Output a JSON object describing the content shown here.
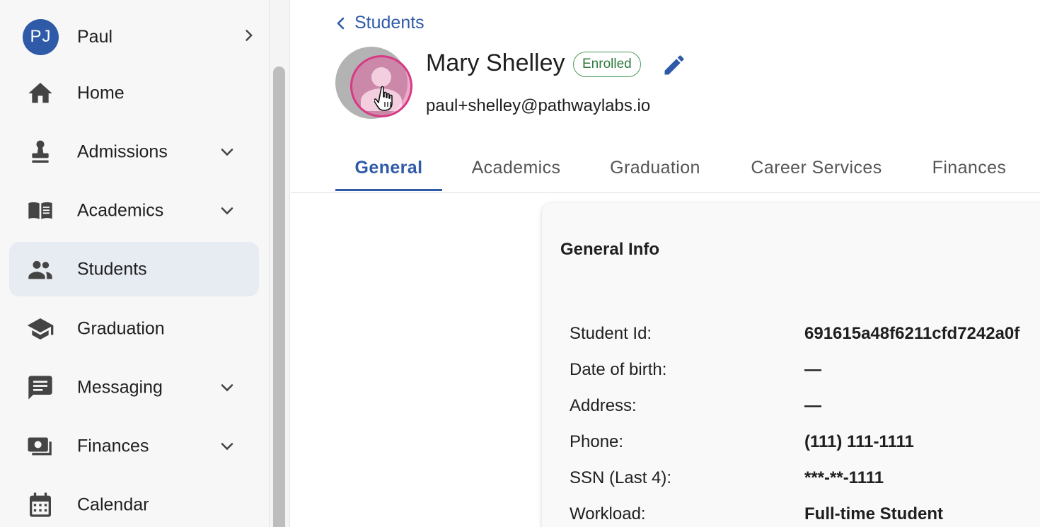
{
  "user": {
    "initials": "PJ",
    "name": "Paul"
  },
  "sidebar": {
    "items": [
      {
        "label": "Home",
        "icon": "home-icon",
        "has_chevron": false,
        "active": false
      },
      {
        "label": "Admissions",
        "icon": "stamp-icon",
        "has_chevron": true,
        "active": false
      },
      {
        "label": "Academics",
        "icon": "book-icon",
        "has_chevron": true,
        "active": false
      },
      {
        "label": "Students",
        "icon": "people-icon",
        "has_chevron": false,
        "active": true
      },
      {
        "label": "Graduation",
        "icon": "graduation-cap-icon",
        "has_chevron": false,
        "active": false
      },
      {
        "label": "Messaging",
        "icon": "message-icon",
        "has_chevron": true,
        "active": false
      },
      {
        "label": "Finances",
        "icon": "money-icon",
        "has_chevron": true,
        "active": false
      },
      {
        "label": "Calendar",
        "icon": "calendar-icon",
        "has_chevron": false,
        "active": false
      }
    ]
  },
  "breadcrumb": {
    "back_label": "Students"
  },
  "student": {
    "name": "Mary Shelley",
    "status": "Enrolled",
    "email": "paul+shelley@pathwaylabs.io"
  },
  "tabs": [
    {
      "label": "General",
      "active": true
    },
    {
      "label": "Academics",
      "active": false
    },
    {
      "label": "Graduation",
      "active": false
    },
    {
      "label": "Career Services",
      "active": false
    },
    {
      "label": "Finances",
      "active": false
    }
  ],
  "general_info": {
    "title": "General Info",
    "rows": [
      {
        "label": "Student Id:",
        "value": "691615a48f6211cfd7242a0f"
      },
      {
        "label": "Date of birth:",
        "value": "—"
      },
      {
        "label": "Address:",
        "value": "—"
      },
      {
        "label": "Phone:",
        "value": "(111) 111-1111"
      },
      {
        "label": "SSN (Last 4):",
        "value": "***-**-1111"
      },
      {
        "label": "Workload:",
        "value": "Full-time Student"
      }
    ]
  },
  "colors": {
    "accent": "#2f5aa8",
    "active_nav_bg": "#e7ebf2",
    "enrolled_green": "#2d7a3b",
    "photo_ring": "#d63a84"
  }
}
